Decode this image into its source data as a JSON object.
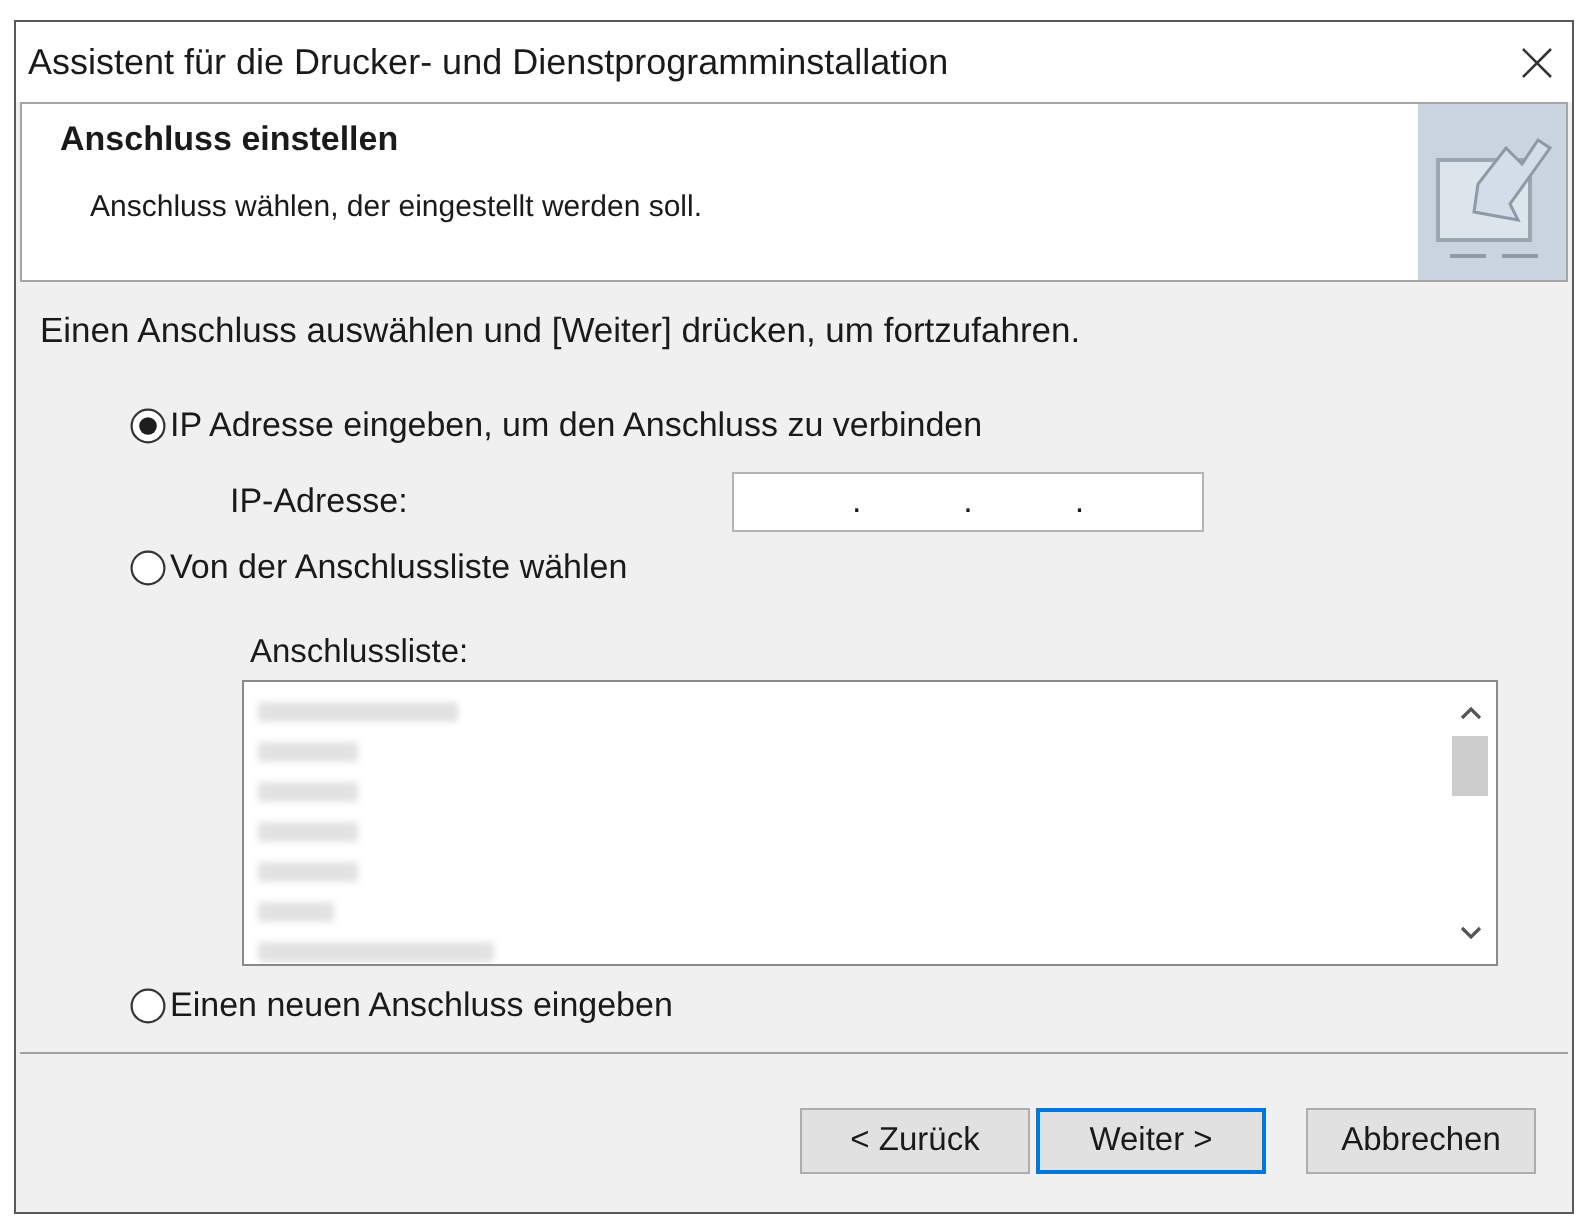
{
  "window": {
    "title": "Assistent für die Drucker- und Dienstprogramminstallation"
  },
  "header": {
    "title": "Anschluss einstellen",
    "subtitle": "Anschluss wählen, der eingestellt werden soll."
  },
  "instruction": "Einen Anschluss auswählen und [Weiter] drücken, um fortzufahren.",
  "options": [
    {
      "kind": "ip",
      "label": "IP Adresse eingeben, um den Anschluss zu verbinden",
      "selected": true,
      "field_label": "IP-Adresse:",
      "separators": [
        ".",
        ".",
        "."
      ]
    },
    {
      "kind": "list",
      "label": "Von der Anschlussliste wählen",
      "selected": false,
      "list_label": "Anschlussliste:"
    },
    {
      "kind": "plain",
      "label": "Einen neuen Anschluss eingeben",
      "selected": false
    }
  ],
  "buttons": [
    {
      "label": "< Zurück",
      "focused": false
    },
    {
      "label": "Weiter >",
      "focused": true
    },
    {
      "label": "Abbrechen",
      "focused": false
    }
  ]
}
